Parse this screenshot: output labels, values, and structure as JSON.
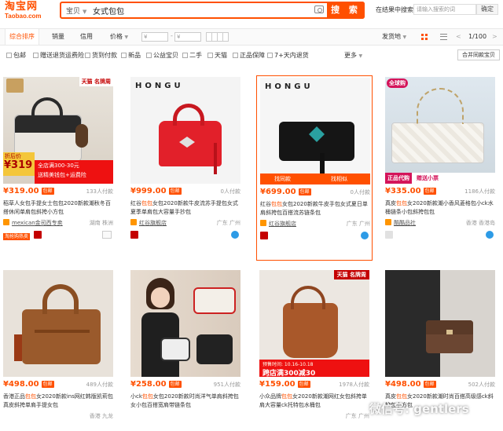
{
  "header": {
    "logo_cn": "淘宝网",
    "logo_en": "Taobao.com",
    "search_type": "宝贝",
    "search_query": "女式包包",
    "search_button": "搜 索",
    "store_search_label": "在结果中搜索",
    "store_search_placeholder": "请输入搜索的词",
    "store_search_button": "确定"
  },
  "sortbar": {
    "items": [
      "综合排序",
      "销量",
      "信用",
      "价格"
    ],
    "price_from": "¥",
    "price_to": "¥",
    "price_sep": "-",
    "ship_from": "发货地",
    "page": "1/100",
    "prev": "<",
    "next": ">"
  },
  "filters": {
    "items": [
      "包邮",
      "赠送退货运费险",
      "货到付款",
      "新品",
      "公益宝贝",
      "二手",
      "天猫",
      "正品保障",
      "7+天内退货"
    ],
    "more": "更多",
    "merge": "合并同款宝贝"
  },
  "products": [
    {
      "price": "¥319.00",
      "bao": "包邮",
      "buyers": "133人付款",
      "title_pre": "稻草人女包手提女士包包2020新款潮秋冬",
      "title_kw": "",
      "title_post": "百搭休闲单肩包斜挎小方包",
      "shop": "mexican金司西专卖",
      "location": "湖南 株洲",
      "img_banner": "天猫 名牌周",
      "img_tag_a": "折后价",
      "img_tag_b": "¥319",
      "img_tag_c": "全店满300-30元",
      "img_tag_d": "送精美钱包+运费险",
      "badge": "淘抢购热卖"
    },
    {
      "price": "¥999.00",
      "bao": "包邮",
      "buyers": "0人付款",
      "title_pre": "红谷",
      "title_kw": "包包",
      "title_post": "女包2020新款牛皮流苏手提包女式夏季单肩包大容量手抄包",
      "shop": "红谷旗舰店",
      "location": "广东 广州",
      "img_brand": "HONGU"
    },
    {
      "price": "¥699.00",
      "bao": "包邮",
      "buyers": "0人付款",
      "title_pre": "红谷",
      "title_kw": "包包",
      "title_post": "女包2020新款牛皮手包女式夏日单肩斜挎包百搭流苏链条包",
      "shop": "红谷旗舰店",
      "location": "广东 广州",
      "img_brand": "HONGU",
      "img_footer_a": "找同款",
      "img_footer_b": "找相似"
    },
    {
      "price": "¥335.00",
      "bao": "包邮",
      "buyers": "1186人付款",
      "title_pre": "真皮",
      "title_kw": "包包",
      "title_post": "女2020新款潮小香风菱格包小ck水桶链条小包斜挎包包",
      "shop": "酷酷品社",
      "location": "香港 香港岛",
      "img_banner": "全球购",
      "img_tag_a": "正品代购",
      "img_tag_b": "赠送小票"
    },
    {
      "price": "¥498.00",
      "bao": "包邮",
      "buyers": "489人付款",
      "title_pre": "香港正品",
      "title_kw": "包包",
      "title_post": "女2020新款ins网红韩版凯莉包真皮斜挎单肩手提女包",
      "shop": "",
      "location": "香港 九龙"
    },
    {
      "price": "¥258.00",
      "bao": "包邮",
      "buyers": "951人付款",
      "title_pre": "小ck",
      "title_kw": "包包",
      "title_post": "女包2020新款时尚洋气单肩斜挎包女小包百搭宽肩带链条包",
      "shop": "",
      "location": ""
    },
    {
      "price": "¥159.00",
      "bao": "包邮",
      "buyers": "1978人付款",
      "title_pre": "小众品牌",
      "title_kw": "包包",
      "title_post": "女2020新款潮网红女包斜挎单肩大容量ck托特包水桶包",
      "shop": "",
      "location": "广东 广州",
      "img_banner": "天猫 名牌周",
      "img_tag_a": "跨店满300减30",
      "img_tag_b": "预售时间: 10.16-10.18"
    },
    {
      "price": "¥498.00",
      "bao": "包邮",
      "buyers": "502人付款",
      "title_pre": "真皮",
      "title_kw": "包包",
      "title_post": "女2020新款潮时尚百搭高级感ck斜挎包小方包",
      "shop": "",
      "location": ""
    }
  ],
  "watermark": "微信号: gentlers"
}
